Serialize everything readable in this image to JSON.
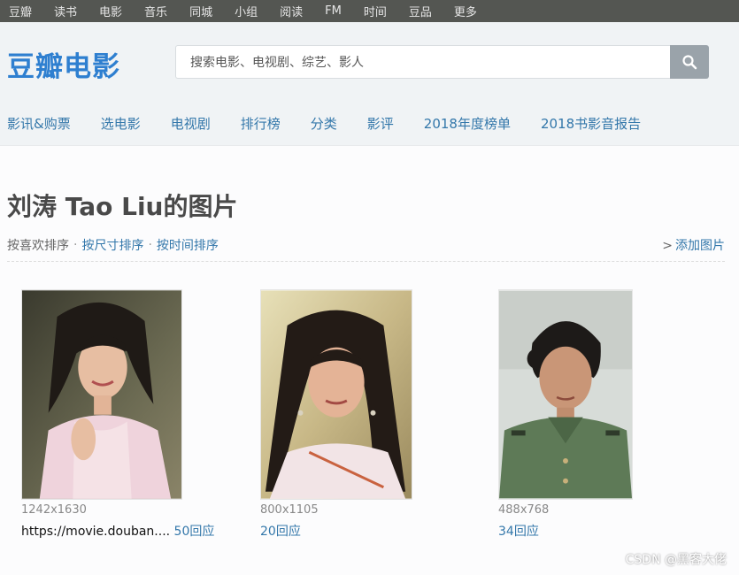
{
  "topnav": [
    "豆瓣",
    "读书",
    "电影",
    "音乐",
    "同城",
    "小组",
    "阅读",
    "FM",
    "时间",
    "豆品",
    "更多"
  ],
  "header": {
    "logo": "豆瓣电影",
    "search_placeholder": "搜索电影、电视剧、综艺、影人",
    "search_icon": "search-icon"
  },
  "subnav": [
    "影讯&购票",
    "选电影",
    "电视剧",
    "排行榜",
    "分类",
    "影评",
    "2018年度榜单",
    "2018书影音报告"
  ],
  "page": {
    "title": "刘涛 Tao Liu的图片",
    "sort_like": "按喜欢排序",
    "sort_size": "按尺寸排序",
    "sort_time": "按时间排序",
    "add_prefix": ">",
    "add_label": "添加图片"
  },
  "photos": [
    {
      "dim": "1242x1630",
      "link": "https://movie.douban....",
      "reply": "50回应"
    },
    {
      "dim": "800x1105",
      "link": "",
      "reply": "20回应"
    },
    {
      "dim": "488x768",
      "link": "",
      "reply": "34回应"
    }
  ],
  "watermark": "CSDN @黑客大佬",
  "colors": {
    "link": "#3377aa",
    "logo": "#2e7fd0",
    "topbar": "#545652",
    "header_bg": "#f0f3f5"
  }
}
